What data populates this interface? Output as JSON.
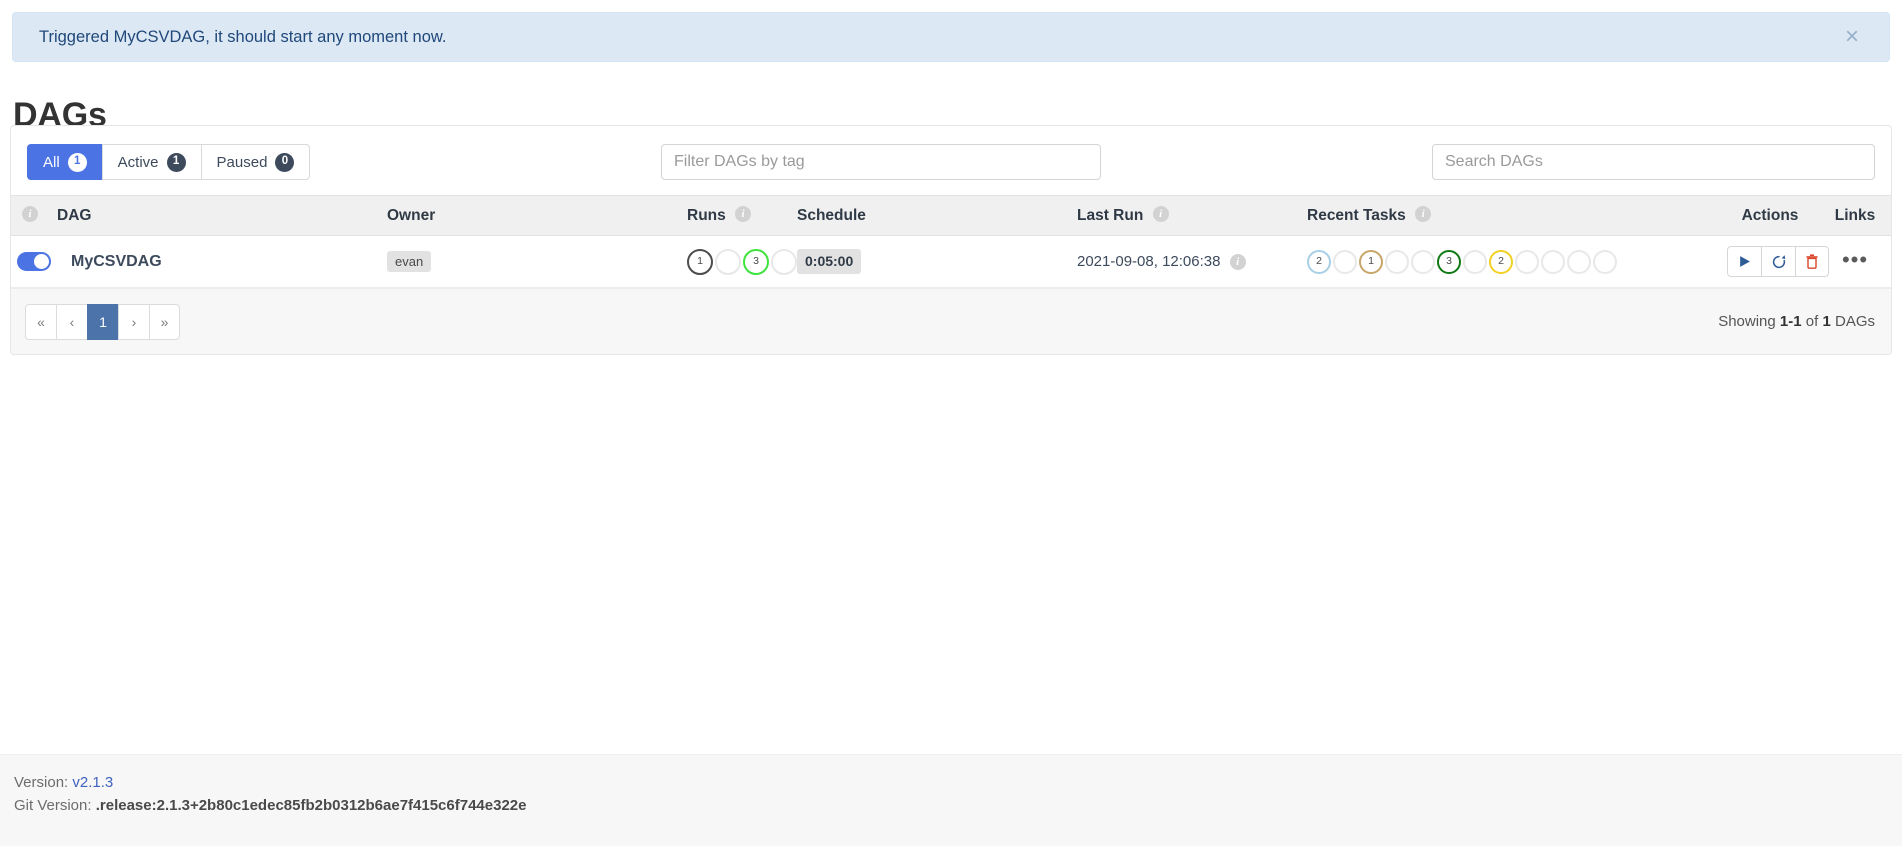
{
  "alert": {
    "message": "Triggered MyCSVDAG, it should start any moment now.",
    "close_label": "×"
  },
  "page_title": "DAGs",
  "filters": {
    "tabs": [
      {
        "label": "All",
        "count": "1",
        "active": true
      },
      {
        "label": "Active",
        "count": "1",
        "active": false
      },
      {
        "label": "Paused",
        "count": "0",
        "active": false
      }
    ],
    "tag_filter_placeholder": "Filter DAGs by tag",
    "tag_filter_value": "",
    "search_placeholder": "Search DAGs",
    "search_value": ""
  },
  "table": {
    "columns": {
      "toggle_info": "i",
      "dag": "DAG",
      "owner": "Owner",
      "runs": "Runs",
      "runs_info": "i",
      "schedule": "Schedule",
      "last_run": "Last Run",
      "last_run_info": "i",
      "recent_tasks": "Recent Tasks",
      "recent_tasks_info": "i",
      "actions": "Actions",
      "links": "Links"
    },
    "rows": [
      {
        "paused_toggle_on": true,
        "dag_id": "MyCSVDAG",
        "owner": "evan",
        "runs": [
          {
            "count": "1",
            "color": "#4d4d4d",
            "state": "queued"
          },
          {
            "count": "",
            "color": "#e8e8e8",
            "state": "running"
          },
          {
            "count": "3",
            "color": "#3ee33e",
            "state": "success"
          },
          {
            "count": "",
            "color": "#e8e8e8",
            "state": "failed"
          }
        ],
        "schedule": "0:05:00",
        "last_run": "2021-09-08, 12:06:38",
        "last_run_info": "i",
        "recent_tasks": [
          {
            "count": "2",
            "color": "#a8cfe5",
            "state": "none"
          },
          {
            "count": "",
            "color": "#e8e8e8",
            "state": "removed"
          },
          {
            "count": "1",
            "color": "#c8a569",
            "state": "scheduled"
          },
          {
            "count": "",
            "color": "#e8e8e8",
            "state": "queued"
          },
          {
            "count": "",
            "color": "#e8e8e8",
            "state": "running"
          },
          {
            "count": "3",
            "color": "#0f7a14",
            "state": "success"
          },
          {
            "count": "",
            "color": "#e8e8e8",
            "state": "restarting"
          },
          {
            "count": "2",
            "color": "#f2d024",
            "state": "up_for_retry"
          },
          {
            "count": "",
            "color": "#e8e8e8",
            "state": "up_for_reschedule"
          },
          {
            "count": "",
            "color": "#e8e8e8",
            "state": "upstream_failed"
          },
          {
            "count": "",
            "color": "#e8e8e8",
            "state": "skipped"
          },
          {
            "count": "",
            "color": "#e8e8e8",
            "state": "deferred"
          }
        ],
        "actions": {
          "trigger_label": "▶",
          "refresh_label": "⟳",
          "delete_label": "🗑"
        },
        "links_label": "•••"
      }
    ]
  },
  "pagination": {
    "first": "«",
    "prev": "‹",
    "pages": [
      "1"
    ],
    "next": "›",
    "last": "»",
    "showing_prefix": "Showing",
    "showing_range": "1-1",
    "showing_middle": "of",
    "showing_total": "1",
    "showing_suffix": "DAGs"
  },
  "footer": {
    "version_label": "Version:",
    "version_value": "v2.1.3",
    "git_version_label": "Git Version:",
    "git_version_value": ".release:2.1.3+2b80c1edec85fb2b0312b6ae7f415c6f744e322e"
  },
  "colors": {
    "accent_blue": "#4b73e3",
    "pagination_blue": "#4c74ab",
    "alert_bg": "#dce9f5",
    "alert_text": "#20487a",
    "delete_red": "#d9452a",
    "action_blue": "#2f5c97"
  }
}
